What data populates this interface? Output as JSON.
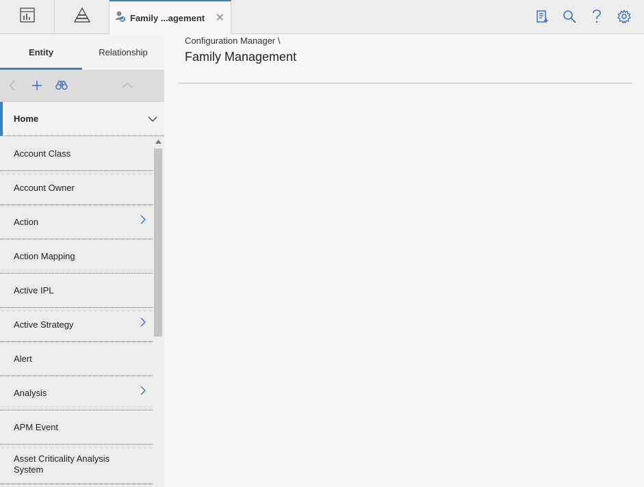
{
  "app": {
    "open_tab": {
      "label": "Family ...agement",
      "close_glyph": "✕",
      "icon": "family-management-icon"
    },
    "toolbar_icons": [
      "dashboard-icon",
      "pyramid-icon",
      "clipboard-add-icon",
      "search-icon",
      "help-icon",
      "gear-icon"
    ]
  },
  "sidebar": {
    "subtabs": [
      {
        "label": "Entity",
        "active": true
      },
      {
        "label": "Relationship",
        "active": false
      }
    ],
    "home": {
      "label": "Home"
    },
    "items": [
      {
        "label": "Account Class",
        "has_children": false
      },
      {
        "label": "Account Owner",
        "has_children": false
      },
      {
        "label": "Action",
        "has_children": true
      },
      {
        "label": "Action Mapping",
        "has_children": false
      },
      {
        "label": "Active IPL",
        "has_children": false
      },
      {
        "label": "Active Strategy",
        "has_children": true
      },
      {
        "label": "Alert",
        "has_children": false
      },
      {
        "label": "Analysis",
        "has_children": true
      },
      {
        "label": "APM Event",
        "has_children": false
      },
      {
        "label": "Asset Criticality Analysis System",
        "has_children": false
      }
    ]
  },
  "main": {
    "breadcrumb": "Configuration Manager \\",
    "title": "Family Management"
  },
  "colors": {
    "accent": "#3b82c4",
    "icon_blue": "#3b6fc4"
  }
}
